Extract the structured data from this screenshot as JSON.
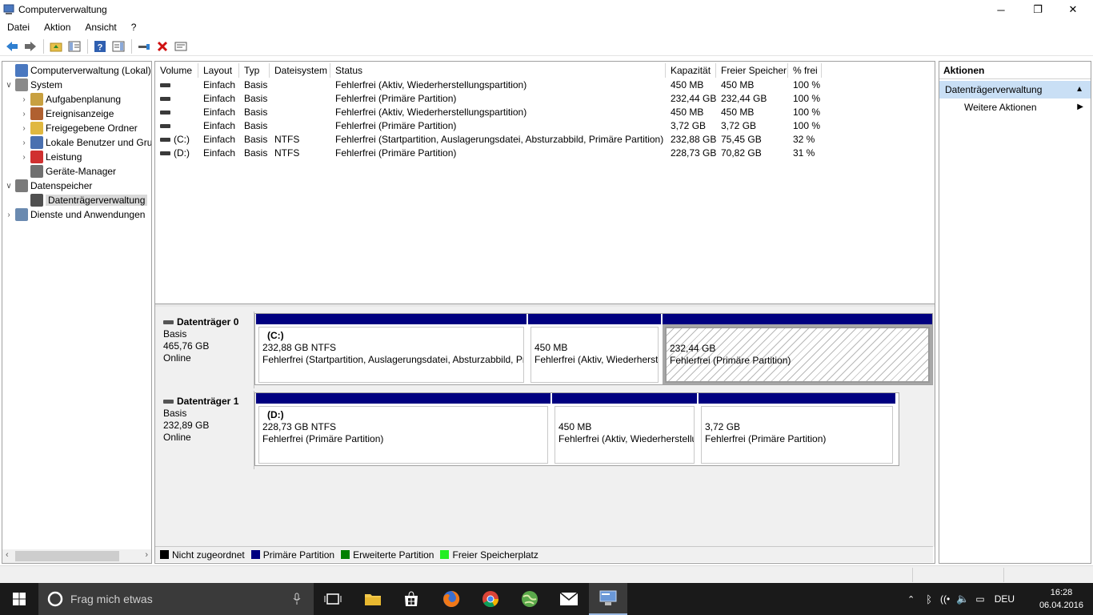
{
  "window": {
    "title": "Computerverwaltung",
    "minimize": "─",
    "restore": "❐",
    "close": "✕"
  },
  "menu": [
    "Datei",
    "Aktion",
    "Ansicht",
    "?"
  ],
  "toolbar": {
    "icons": [
      "back-arrow-icon",
      "forward-arrow-icon",
      "folder-up-icon",
      "show-hide-tree-icon",
      "help-icon",
      "properties-icon",
      "connect-icon",
      "delete-icon",
      "properties-list-icon"
    ]
  },
  "tree": {
    "items": [
      {
        "label": "Computerverwaltung (Lokal)",
        "level": 0,
        "expander": "",
        "icon": "computer-management-icon"
      },
      {
        "label": "System",
        "level": 0,
        "expander": "∨",
        "icon": "tools-icon"
      },
      {
        "label": "Aufgabenplanung",
        "level": 1,
        "expander": "›",
        "icon": "clock-icon"
      },
      {
        "label": "Ereignisanzeige",
        "level": 1,
        "expander": "›",
        "icon": "event-viewer-icon"
      },
      {
        "label": "Freigegebene Ordner",
        "level": 1,
        "expander": "›",
        "icon": "shared-folder-icon"
      },
      {
        "label": "Lokale Benutzer und Gru",
        "level": 1,
        "expander": "›",
        "icon": "users-icon"
      },
      {
        "label": "Leistung",
        "level": 1,
        "expander": "›",
        "icon": "performance-icon"
      },
      {
        "label": "Geräte-Manager",
        "level": 1,
        "expander": "",
        "icon": "device-manager-icon"
      },
      {
        "label": "Datenspeicher",
        "level": 0,
        "expander": "∨",
        "icon": "storage-icon"
      },
      {
        "label": "Datenträgerverwaltung",
        "level": 1,
        "expander": "",
        "icon": "disk-management-icon",
        "selected": true
      },
      {
        "label": "Dienste und Anwendungen",
        "level": 0,
        "expander": "›",
        "icon": "services-icon"
      }
    ]
  },
  "volumes": {
    "columns": [
      "Volume",
      "Layout",
      "Typ",
      "Dateisystem",
      "Status",
      "Kapazität",
      "Freier Speicher",
      "% frei"
    ],
    "rows": [
      {
        "volume": "",
        "layout": "Einfach",
        "typ": "Basis",
        "fs": "",
        "status": "Fehlerfrei (Aktiv, Wiederherstellungspartition)",
        "kap": "450 MB",
        "frei": "450 MB",
        "pct": "100 %"
      },
      {
        "volume": "",
        "layout": "Einfach",
        "typ": "Basis",
        "fs": "",
        "status": "Fehlerfrei (Primäre Partition)",
        "kap": "232,44 GB",
        "frei": "232,44 GB",
        "pct": "100 %"
      },
      {
        "volume": "",
        "layout": "Einfach",
        "typ": "Basis",
        "fs": "",
        "status": "Fehlerfrei (Aktiv, Wiederherstellungspartition)",
        "kap": "450 MB",
        "frei": "450 MB",
        "pct": "100 %"
      },
      {
        "volume": "",
        "layout": "Einfach",
        "typ": "Basis",
        "fs": "",
        "status": "Fehlerfrei (Primäre Partition)",
        "kap": "3,72 GB",
        "frei": "3,72 GB",
        "pct": "100 %"
      },
      {
        "volume": "(C:)",
        "layout": "Einfach",
        "typ": "Basis",
        "fs": "NTFS",
        "status": "Fehlerfrei (Startpartition, Auslagerungsdatei, Absturzabbild, Primäre Partition)",
        "kap": "232,88 GB",
        "frei": "75,45 GB",
        "pct": "32 %"
      },
      {
        "volume": "(D:)",
        "layout": "Einfach",
        "typ": "Basis",
        "fs": "NTFS",
        "status": "Fehlerfrei (Primäre Partition)",
        "kap": "228,73 GB",
        "frei": "70,82 GB",
        "pct": "31 %"
      }
    ]
  },
  "disks": [
    {
      "name": "Datenträger 0",
      "type": "Basis",
      "size": "465,76 GB",
      "state": "Online",
      "partitions": [
        {
          "name": "(C:)",
          "size": "232,88 GB NTFS",
          "status": "Fehlerfrei (Startpartition, Auslagerungsdatei, Absturzabbild, Pr",
          "selected": false
        },
        {
          "name": "",
          "size": "450 MB",
          "status": "Fehlerfrei (Aktiv, Wiederherst",
          "selected": false
        },
        {
          "name": "",
          "size": "232,44 GB",
          "status": "Fehlerfrei (Primäre Partition)",
          "selected": true
        }
      ]
    },
    {
      "name": "Datenträger 1",
      "type": "Basis",
      "size": "232,89 GB",
      "state": "Online",
      "partitions": [
        {
          "name": "(D:)",
          "size": "228,73 GB NTFS",
          "status": "Fehlerfrei (Primäre Partition)",
          "selected": false
        },
        {
          "name": "",
          "size": "450 MB",
          "status": "Fehlerfrei (Aktiv, Wiederherstellu",
          "selected": false
        },
        {
          "name": "",
          "size": "3,72 GB",
          "status": "Fehlerfrei (Primäre Partition)",
          "selected": false
        }
      ]
    }
  ],
  "legend": [
    {
      "label": "Nicht zugeordnet",
      "color": "#000000"
    },
    {
      "label": "Primäre Partition",
      "color": "#000080"
    },
    {
      "label": "Erweiterte Partition",
      "color": "#008000"
    },
    {
      "label": "Freier Speicherplatz",
      "color": "#22ee22"
    }
  ],
  "actions": {
    "header": "Aktionen",
    "section": "Datenträgerverwaltung",
    "items": [
      "Weitere Aktionen"
    ]
  },
  "taskbar": {
    "search_placeholder": "Frag mich etwas",
    "language": "DEU",
    "time": "16:28",
    "date": "06.04.2016"
  }
}
